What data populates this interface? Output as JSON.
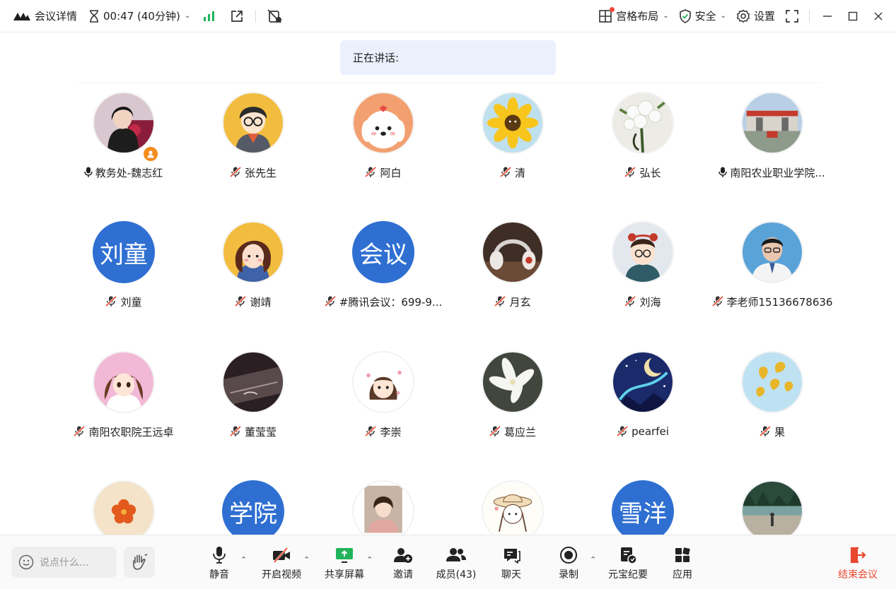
{
  "topbar": {
    "meeting_details": "会议详情",
    "timer": "00:47 (40分钟)",
    "layout": "宫格布局",
    "security": "安全",
    "settings": "设置"
  },
  "speaking": {
    "label": "正在讲话:"
  },
  "participants": [
    {
      "name": "教务处-魏志红",
      "mic": "on",
      "avatar": "photo-woman-icon",
      "host": true
    },
    {
      "name": "张先生",
      "mic": "muted",
      "avatar": "cartoon-boy-glasses-icon"
    },
    {
      "name": "阿白",
      "mic": "muted",
      "avatar": "cartoon-dog-icon"
    },
    {
      "name": "清",
      "mic": "muted",
      "avatar": "sunflower-icon"
    },
    {
      "name": "弘长",
      "mic": "muted",
      "avatar": "white-flowers-icon"
    },
    {
      "name": "南阳农业职业学院...",
      "mic": "on",
      "avatar": "college-gate-icon"
    },
    {
      "name": "刘童",
      "mic": "muted",
      "avatar_text": "刘童"
    },
    {
      "name": "谢靖",
      "mic": "muted",
      "avatar": "cartoon-girl-icon"
    },
    {
      "name": "#腾讯会议：699-9...",
      "mic": "muted",
      "avatar_text": "会议"
    },
    {
      "name": "月玄",
      "mic": "muted",
      "avatar": "headphones-icon"
    },
    {
      "name": "刘海",
      "mic": "muted",
      "avatar": "cartoon-boy-bear-ears-icon"
    },
    {
      "name": "李老师15136678636",
      "mic": "muted",
      "avatar": "photo-man-icon"
    },
    {
      "name": "南阳农职院王远卓",
      "mic": "muted",
      "avatar": "anime-girl-icon"
    },
    {
      "name": "董莹莹",
      "mic": "muted",
      "avatar": "piano-icon"
    },
    {
      "name": "李崇",
      "mic": "muted",
      "avatar": "chibi-girl-icon"
    },
    {
      "name": "葛应兰",
      "mic": "muted",
      "avatar": "white-lily-icon"
    },
    {
      "name": "pearfei",
      "mic": "muted",
      "avatar": "night-sky-icon"
    },
    {
      "name": "果",
      "mic": "muted",
      "avatar": "ginkgo-leaves-icon"
    },
    {
      "name": "",
      "mic": "",
      "avatar": "orange-flower-icon"
    },
    {
      "name": "",
      "mic": "",
      "avatar_text": "学院"
    },
    {
      "name": "",
      "mic": "",
      "avatar": "photo-girl-icon"
    },
    {
      "name": "",
      "mic": "",
      "avatar": "sketch-girl-hat-icon"
    },
    {
      "name": "",
      "mic": "",
      "avatar_text": "雪洋"
    },
    {
      "name": "",
      "mic": "",
      "avatar": "landscape-person-icon"
    }
  ],
  "bottombar": {
    "chat_placeholder": "说点什么...",
    "mute": "静音",
    "video": "开启视频",
    "share": "共享屏幕",
    "invite": "邀请",
    "members": "成员(43)",
    "chat": "聊天",
    "record": "录制",
    "ai_notes": "元宝纪要",
    "apps": "应用",
    "end": "结束会议"
  },
  "colors": {
    "accent_blue": "#2f6fd2",
    "end_red": "#e8482f",
    "signal_green": "#21b35a",
    "speaking_bg": "#eaf1fd"
  }
}
